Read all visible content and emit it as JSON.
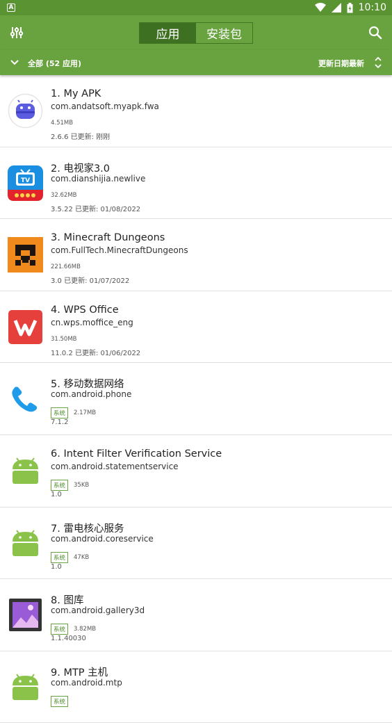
{
  "status_bar": {
    "notification_letter": "A",
    "time": "10:10"
  },
  "app_bar": {
    "tabs": [
      {
        "label": "应用",
        "active": true
      },
      {
        "label": "安装包",
        "active": false
      }
    ]
  },
  "sub_bar": {
    "filter_label": "全部 (52 应用)",
    "sort_label": "更新日期最新"
  },
  "apps": [
    {
      "title": "1. My APK",
      "package": "com.andatsoft.myapk.fwa",
      "system": false,
      "size": "4.51MB",
      "version_line": "2.6.6  已更新: 刚刚",
      "icon": "myapk-icon"
    },
    {
      "title": "2. 电视家3.0",
      "package": "com.dianshijia.newlive",
      "system": false,
      "size": "32.62MB",
      "version_line": "3.5.22  已更新: 01/08/2022",
      "icon": "tv-icon"
    },
    {
      "title": "3. Minecraft Dungeons",
      "package": "com.FullTech.MinecraftDungeons",
      "system": false,
      "size": "221.66MB",
      "version_line": "3.0  已更新: 01/07/2022",
      "icon": "minecraft-icon"
    },
    {
      "title": "4. WPS Office",
      "package": "cn.wps.moffice_eng",
      "system": false,
      "size": "31.50MB",
      "version_line": " 11.0.2  已更新: 01/06/2022",
      "icon": "wps-icon"
    },
    {
      "title": "5. 移动数据网络",
      "package": "com.android.phone",
      "system": true,
      "badge": "系统",
      "size": "2.17MB",
      "version_line": "7.1.2",
      "icon": "phone-icon"
    },
    {
      "title": "6. Intent Filter Verification Service",
      "package": "com.android.statementservice",
      "system": true,
      "badge": "系统",
      "size": "35KB",
      "version_line": "1.0",
      "icon": "android-icon"
    },
    {
      "title": "7. 雷电核心服务",
      "package": "com.android.coreservice",
      "system": true,
      "badge": "系统",
      "size": "47KB",
      "version_line": "1.0",
      "icon": "android-icon"
    },
    {
      "title": "8. 图库",
      "package": "com.android.gallery3d",
      "system": true,
      "badge": "系统",
      "size": "3.82MB",
      "version_line": "1.1.40030",
      "icon": "gallery-icon"
    },
    {
      "title": "9. MTP 主机",
      "package": "com.android.mtp",
      "system": true,
      "badge": "系统",
      "size": "",
      "version_line": "",
      "icon": "android-icon"
    }
  ]
}
